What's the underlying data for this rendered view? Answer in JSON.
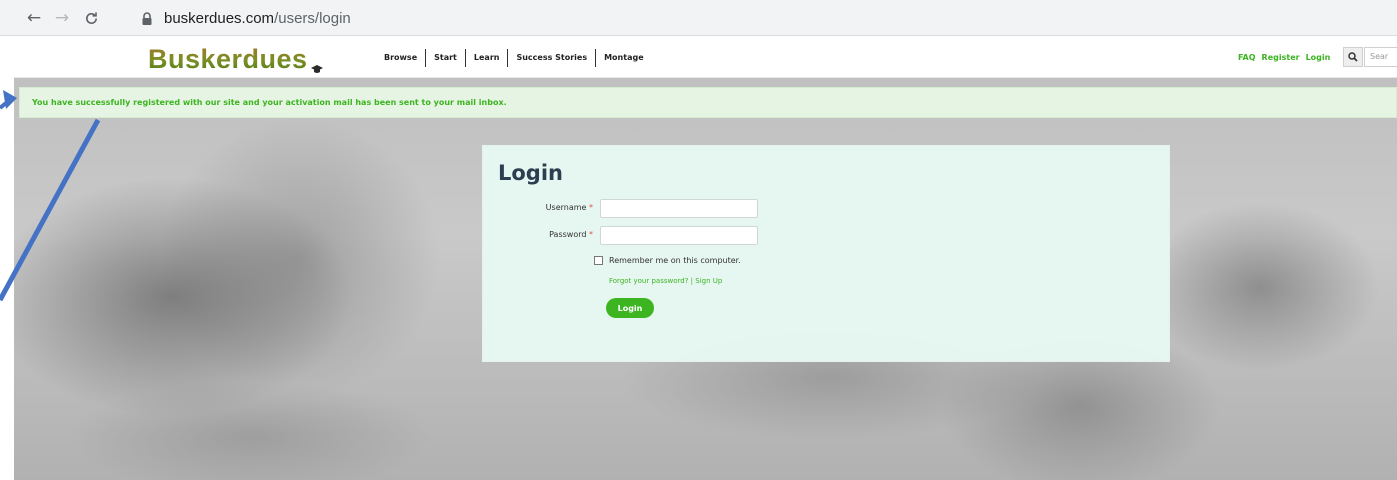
{
  "browser": {
    "url_host": "buskerdues.com",
    "url_path": "/users/login"
  },
  "header": {
    "logo_text": "Buskerdues",
    "nav": [
      "Browse",
      "Start",
      "Learn",
      "Success Stories",
      "Montage"
    ],
    "right_links": [
      "FAQ",
      "Register",
      "Login"
    ],
    "search_placeholder": "Sear"
  },
  "alert": {
    "message": "You have successfully registered with our site and your activation mail has been sent to your mail inbox."
  },
  "login": {
    "title": "Login",
    "username_label": "Username",
    "password_label": "Password",
    "required_mark": "*",
    "remember_label": "Remember me on this computer.",
    "forgot_link": "Forgot your password?",
    "link_separator": "|",
    "signup_link": "Sign Up",
    "submit_label": "Login"
  },
  "colors": {
    "accent_green": "#3cb521",
    "annotation_arrow": "#4472c4",
    "required_red": "#d9534f"
  }
}
